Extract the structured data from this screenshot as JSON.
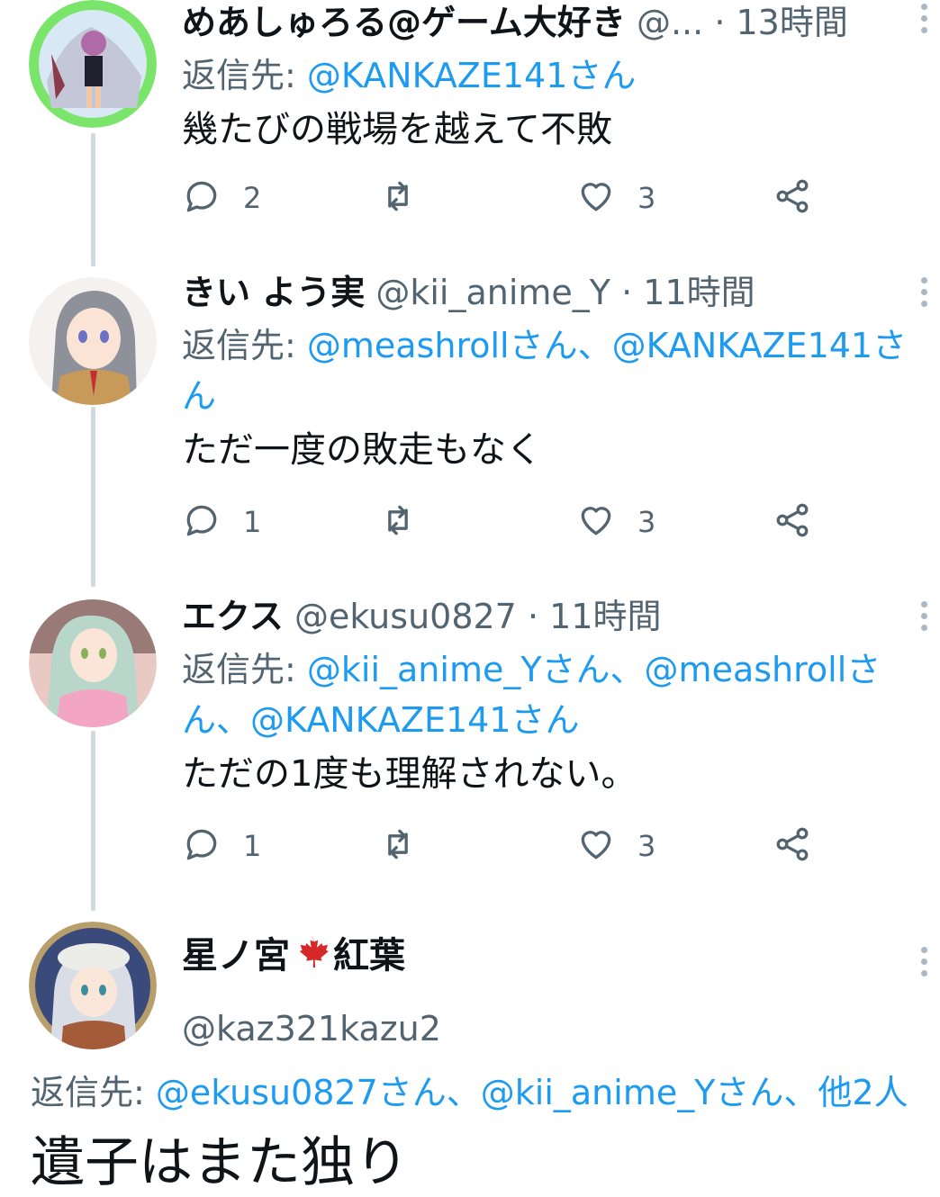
{
  "tweets": [
    {
      "name": "めあしゅろる@ゲーム大好き",
      "handle": "@...",
      "dot": "·",
      "time": "13時間",
      "reply_prefix": "返信先: ",
      "reply_text": "@KANKAZE141さん",
      "body": "幾たびの戦場を越えて不敗",
      "replies": "2",
      "likes": "3"
    },
    {
      "name": "きい よう実",
      "handle": "@kii_anime_Y",
      "dot": "·",
      "time": "11時間",
      "reply_prefix": "返信先: ",
      "reply_text": "@meashrollさん、@KANKAZE141さん",
      "body": "ただ一度の敗走もなく",
      "replies": "1",
      "likes": "3"
    },
    {
      "name": "エクス",
      "handle": "@ekusu0827",
      "dot": "·",
      "time": "11時間",
      "reply_prefix": "返信先: ",
      "reply_text": "@kii_anime_Yさん、@meashrollさん、@KANKAZE141さん",
      "body": "ただの1度も理解されない。",
      "replies": "1",
      "likes": "3"
    }
  ],
  "focused": {
    "name_part1": "星ノ宮",
    "name_part2": "紅葉",
    "handle": "@kaz321kazu2",
    "reply_prefix": "返信先: ",
    "reply_text": "@ekusu0827さん、@kii_anime_Yさん、他2人",
    "body": "遺子はまた独り"
  },
  "colors": {
    "accent": "#1d9bf0",
    "muted": "#536471",
    "thread_line": "#cfd9de",
    "maple": "#d62828"
  },
  "icons": [
    "reply-icon",
    "retweet-icon",
    "like-icon",
    "share-icon",
    "more-icon",
    "maple-leaf-icon"
  ]
}
